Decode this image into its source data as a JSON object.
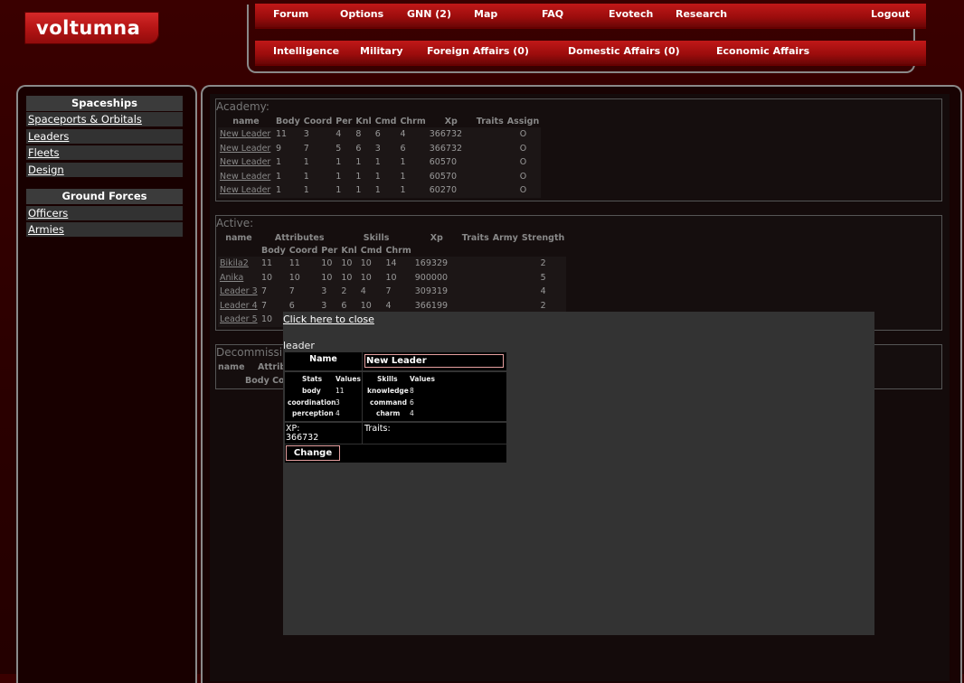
{
  "brand": {
    "name": "voltumna"
  },
  "nav": {
    "top": [
      {
        "label": "Forum"
      },
      {
        "label": "Options"
      },
      {
        "label": "GNN (2)"
      },
      {
        "label": "Map"
      },
      {
        "label": "FAQ"
      },
      {
        "label": "Evotech"
      },
      {
        "label": "Research"
      },
      {
        "label": "Logout"
      }
    ],
    "bottom": [
      {
        "label": "Intelligence"
      },
      {
        "label": "Military"
      },
      {
        "label": "Foreign Affairs (0)"
      },
      {
        "label": "Domestic Affairs (0)"
      },
      {
        "label": "Economic Affairs"
      }
    ]
  },
  "sidebar": {
    "spaceships_heading": "Spaceships",
    "spaceships": [
      {
        "label": "Spaceports & Orbitals"
      },
      {
        "label": "Leaders"
      },
      {
        "label": "Fleets"
      },
      {
        "label": "Design"
      }
    ],
    "ground_heading": "Ground Forces",
    "ground": [
      {
        "label": "Officers"
      },
      {
        "label": "Armies"
      }
    ]
  },
  "academy": {
    "title": "Academy:",
    "headers": [
      "name",
      "Body",
      "Coord",
      "Per",
      "Knl",
      "Cmd",
      "Chrm",
      "Xp",
      "Traits",
      "Assign"
    ],
    "rows": [
      [
        "New Leader",
        "11",
        "3",
        "4",
        "8",
        "6",
        "4",
        "366732",
        "",
        "O"
      ],
      [
        "New Leader",
        "9",
        "7",
        "5",
        "6",
        "3",
        "6",
        "366732",
        "",
        "O"
      ],
      [
        "New Leader",
        "1",
        "1",
        "1",
        "1",
        "1",
        "1",
        "60570",
        "",
        "O"
      ],
      [
        "New Leader",
        "1",
        "1",
        "1",
        "1",
        "1",
        "1",
        "60570",
        "",
        "O"
      ],
      [
        "New Leader",
        "1",
        "1",
        "1",
        "1",
        "1",
        "1",
        "60270",
        "",
        "O"
      ]
    ]
  },
  "active": {
    "title": "Active:",
    "group_headers": [
      "name",
      "Attributes",
      "Skills",
      "Xp",
      "Traits",
      "Army",
      "Strength"
    ],
    "sub_headers": [
      "Body",
      "Coord",
      "Per",
      "Knl",
      "Cmd",
      "Chrm"
    ],
    "rows": [
      [
        "Bikila2",
        "11",
        "11",
        "10",
        "10",
        "10",
        "14",
        "169329",
        "",
        "",
        "2"
      ],
      [
        "Anika",
        "10",
        "10",
        "10",
        "10",
        "10",
        "10",
        "900000",
        "",
        "",
        "5"
      ],
      [
        "Leader 3",
        "7",
        "7",
        "3",
        "2",
        "4",
        "7",
        "309319",
        "",
        "",
        "4"
      ],
      [
        "Leader 4",
        "7",
        "6",
        "3",
        "6",
        "10",
        "4",
        "366199",
        "",
        "",
        "2"
      ],
      [
        "Leader 5",
        "10",
        "",
        "",
        "",
        "",
        "",
        "",
        "",
        "",
        ""
      ]
    ]
  },
  "decommissioned": {
    "title": "Decommissi",
    "h1": "name",
    "h2": "Attrib",
    "h3": "Body Co"
  },
  "popup": {
    "close_label": "Click here to close",
    "label": "leader",
    "name_label": "Name",
    "name_value": "New Leader",
    "stats_header": "Stats",
    "values_header": "Values",
    "skills_header": "Skills",
    "stats": [
      {
        "k": "body",
        "v": "11"
      },
      {
        "k": "coordination",
        "v": "3"
      },
      {
        "k": "perception",
        "v": "4"
      }
    ],
    "skills": [
      {
        "k": "knowledge",
        "v": "8"
      },
      {
        "k": "command",
        "v": "6"
      },
      {
        "k": "charm",
        "v": "4"
      }
    ],
    "xp_label": "XP:",
    "xp_value": "366732",
    "traits_label": "Traits:",
    "change_label": "Change"
  }
}
